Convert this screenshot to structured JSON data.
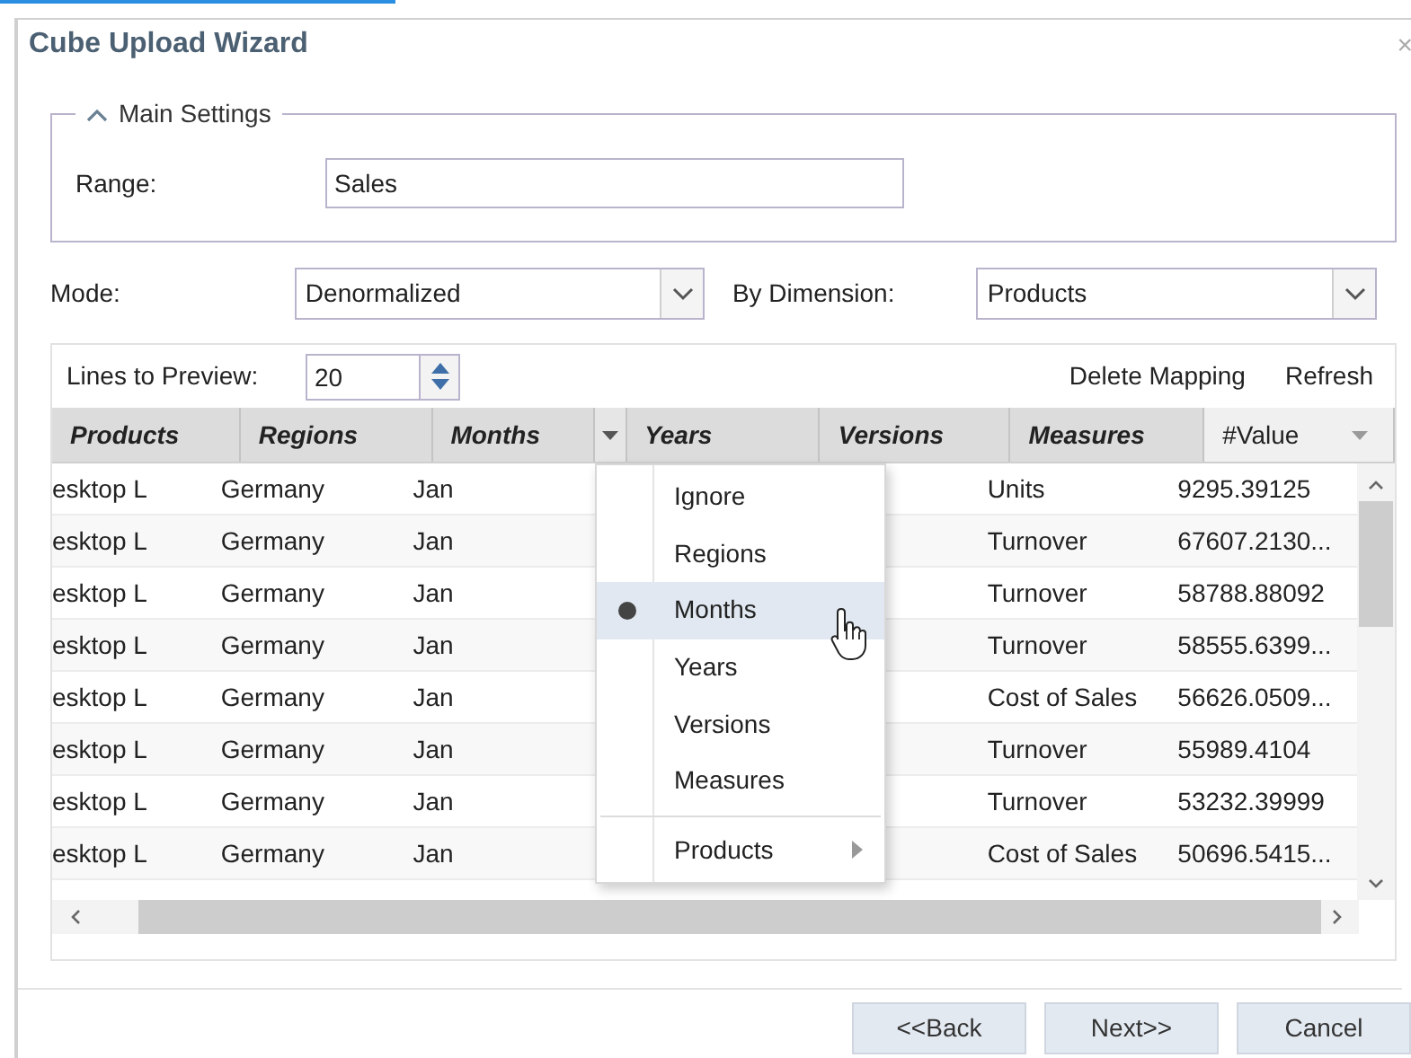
{
  "window": {
    "title": "Cube Upload Wizard",
    "close": "×"
  },
  "main_settings": {
    "title": "Main Settings",
    "expanded": true,
    "range_label": "Range:",
    "range_value": "Sales"
  },
  "mode": {
    "label": "Mode:",
    "value": "Denormalized"
  },
  "by_dimension": {
    "label": "By Dimension:",
    "value": "Products"
  },
  "preview": {
    "lines_label": "Lines to Preview:",
    "lines_value": "20",
    "actions": [
      "Delete Mapping",
      "Refresh"
    ]
  },
  "table": {
    "columns": [
      {
        "label": "Products",
        "kind": "dimension",
        "menu_open": false
      },
      {
        "label": "Regions",
        "kind": "dimension",
        "menu_open": false
      },
      {
        "label": "Months",
        "kind": "dimension",
        "menu_open": true
      },
      {
        "label": "Years",
        "kind": "dimension",
        "menu_open": false
      },
      {
        "label": "Versions",
        "kind": "dimension",
        "menu_open": false
      },
      {
        "label": "Measures",
        "kind": "dimension",
        "menu_open": false
      },
      {
        "label": "#Value",
        "kind": "value",
        "menu_open": false
      }
    ],
    "rows": [
      {
        "product": "esktop L",
        "region": "Germany",
        "month": "Jan",
        "measure": "Units",
        "value": "9295.39125"
      },
      {
        "product": "esktop L",
        "region": "Germany",
        "month": "Jan",
        "measure": "Turnover",
        "value": "67607.2130..."
      },
      {
        "product": "esktop L",
        "region": "Germany",
        "month": "Jan",
        "measure": "Turnover",
        "value": "58788.88092"
      },
      {
        "product": "esktop L",
        "region": "Germany",
        "month": "Jan",
        "measure": "Turnover",
        "value": "58555.6399..."
      },
      {
        "product": "esktop L",
        "region": "Germany",
        "month": "Jan",
        "measure": "Cost of Sales",
        "value": "56626.0509..."
      },
      {
        "product": "esktop L",
        "region": "Germany",
        "month": "Jan",
        "measure": "Turnover",
        "value": "55989.4104"
      },
      {
        "product": "esktop L",
        "region": "Germany",
        "month": "Jan",
        "measure": "Turnover",
        "value": "53232.39999"
      },
      {
        "product": "esktop L",
        "region": "Germany",
        "month": "Jan",
        "measure": "Cost of Sales",
        "value": "50696.5415..."
      }
    ]
  },
  "context_menu": {
    "items": [
      {
        "label": "Ignore",
        "kind": "option",
        "selected": false
      },
      {
        "label": "Regions",
        "kind": "option",
        "selected": false
      },
      {
        "label": "Months",
        "kind": "option",
        "selected": true
      },
      {
        "label": "Years",
        "kind": "option",
        "selected": false
      },
      {
        "label": "Versions",
        "kind": "option",
        "selected": false
      },
      {
        "label": "Measures",
        "kind": "option",
        "selected": false
      },
      {
        "label": "Products",
        "kind": "submenu",
        "selected": false
      }
    ]
  },
  "buttons": [
    "<<Back",
    "Next>>",
    "Cancel"
  ]
}
